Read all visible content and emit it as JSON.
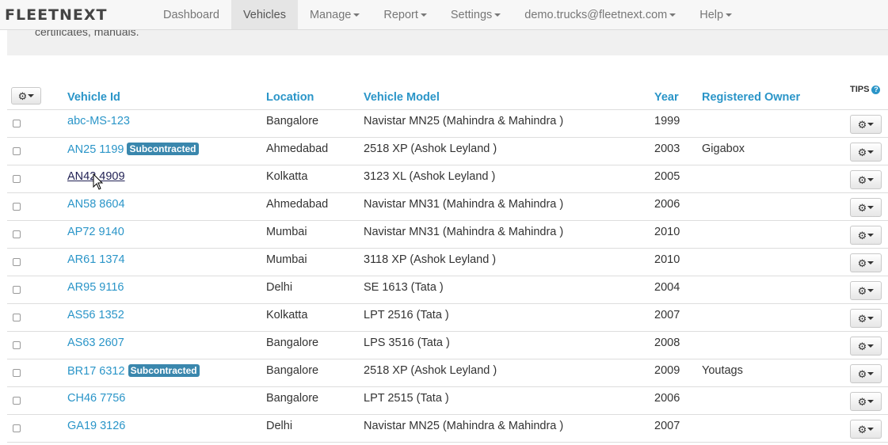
{
  "nav": {
    "brand": "FLEETNEXT",
    "items": [
      {
        "label": "Dashboard",
        "dropdown": false,
        "active": false
      },
      {
        "label": "Vehicles",
        "dropdown": false,
        "active": true
      },
      {
        "label": "Manage",
        "dropdown": true,
        "active": false
      },
      {
        "label": "Report",
        "dropdown": true,
        "active": false
      },
      {
        "label": "Settings",
        "dropdown": true,
        "active": false
      },
      {
        "label": "demo.trucks@fleetnext.com",
        "dropdown": true,
        "active": false
      },
      {
        "label": "Help",
        "dropdown": true,
        "active": false
      }
    ]
  },
  "info_text": "certificates, manuals.",
  "table": {
    "headers": {
      "vehicle_id": "Vehicle Id",
      "location": "Location",
      "vehicle_model": "Vehicle Model",
      "year": "Year",
      "registered_owner": "Registered Owner"
    },
    "tips_label": "TIPS",
    "rows": [
      {
        "vehicle_id": "abc-MS-123",
        "badge": "",
        "location": "Bangalore",
        "model": "Navistar MN25 (Mahindra & Mahindra )",
        "year": "1999",
        "owner": ""
      },
      {
        "vehicle_id": "AN25 1199",
        "badge": "Subcontracted",
        "location": "Ahmedabad",
        "model": "2518 XP (Ashok Leyland )",
        "year": "2003",
        "owner": "Gigabox"
      },
      {
        "vehicle_id": "AN42 4909",
        "badge": "",
        "location": "Kolkatta",
        "model": "3123 XL (Ashok Leyland )",
        "year": "2005",
        "owner": ""
      },
      {
        "vehicle_id": "AN58 8604",
        "badge": "",
        "location": "Ahmedabad",
        "model": "Navistar MN31 (Mahindra & Mahindra )",
        "year": "2006",
        "owner": ""
      },
      {
        "vehicle_id": "AP72 9140",
        "badge": "",
        "location": "Mumbai",
        "model": "Navistar MN31 (Mahindra & Mahindra )",
        "year": "2010",
        "owner": ""
      },
      {
        "vehicle_id": "AR61 1374",
        "badge": "",
        "location": "Mumbai",
        "model": "3118 XP (Ashok Leyland )",
        "year": "2010",
        "owner": ""
      },
      {
        "vehicle_id": "AR95 9116",
        "badge": "",
        "location": "Delhi",
        "model": "SE 1613 (Tata )",
        "year": "2004",
        "owner": ""
      },
      {
        "vehicle_id": "AS56 1352",
        "badge": "",
        "location": "Kolkatta",
        "model": "LPT 2516 (Tata )",
        "year": "2007",
        "owner": ""
      },
      {
        "vehicle_id": "AS63 2607",
        "badge": "",
        "location": "Bangalore",
        "model": "LPS 3516 (Tata )",
        "year": "2008",
        "owner": ""
      },
      {
        "vehicle_id": "BR17 6312",
        "badge": "Subcontracted",
        "location": "Bangalore",
        "model": "2518 XP (Ashok Leyland )",
        "year": "2009",
        "owner": "Youtags"
      },
      {
        "vehicle_id": "CH46 7756",
        "badge": "",
        "location": "Bangalore",
        "model": "LPT 2515 (Tata )",
        "year": "2006",
        "owner": ""
      },
      {
        "vehicle_id": "GA19 3126",
        "badge": "",
        "location": "Delhi",
        "model": "Navistar MN25 (Mahindra & Mahindra )",
        "year": "2007",
        "owner": ""
      }
    ]
  },
  "icons": {
    "gear": "gear-icon",
    "caret": "caret-down-icon",
    "help": "question-circle-icon"
  },
  "colors": {
    "link": "#2a95c8",
    "badge": "#3a87ad"
  }
}
